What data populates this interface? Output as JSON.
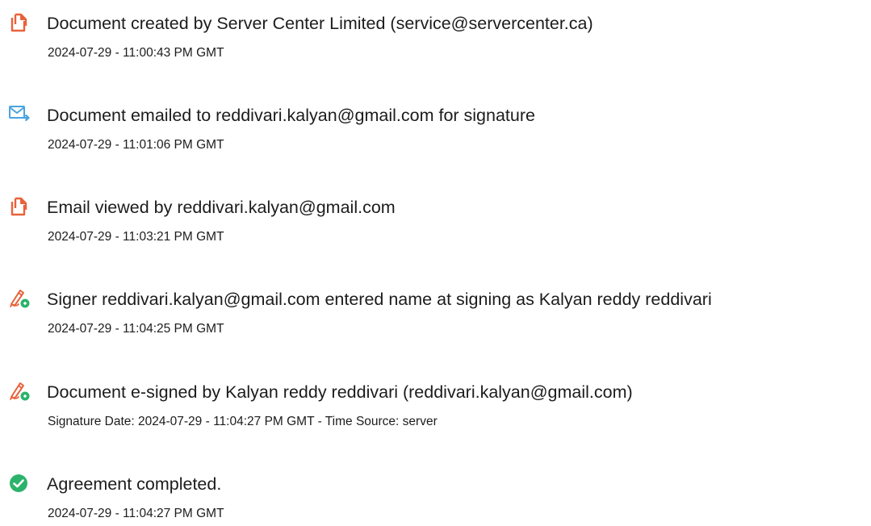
{
  "colors": {
    "doc_icon": "#e8623a",
    "email_icon": "#4aa3df",
    "sign_icon_pen": "#e8623a",
    "sign_icon_badge": "#2cb36b",
    "check_icon": "#2cb36b"
  },
  "events": [
    {
      "icon": "document-icon",
      "title": "Document created by Server Center Limited (service@servercenter.ca)",
      "meta": "2024-07-29 - 11:00:43 PM GMT"
    },
    {
      "icon": "email-send-icon",
      "title": "Document emailed to reddivari.kalyan@gmail.com for signature",
      "meta": "2024-07-29 - 11:01:06 PM GMT"
    },
    {
      "icon": "document-icon",
      "title": "Email viewed by reddivari.kalyan@gmail.com",
      "meta": "2024-07-29 - 11:03:21 PM GMT"
    },
    {
      "icon": "esign-pen-icon",
      "title": "Signer reddivari.kalyan@gmail.com entered name at signing as Kalyan reddy reddivari",
      "meta": "2024-07-29 - 11:04:25 PM GMT"
    },
    {
      "icon": "esign-pen-icon",
      "title": "Document e-signed by Kalyan reddy reddivari (reddivari.kalyan@gmail.com)",
      "meta": "Signature Date: 2024-07-29 - 11:04:27 PM GMT - Time Source: server"
    },
    {
      "icon": "check-circle-icon",
      "title": "Agreement completed.",
      "meta": "2024-07-29 - 11:04:27 PM GMT"
    }
  ]
}
